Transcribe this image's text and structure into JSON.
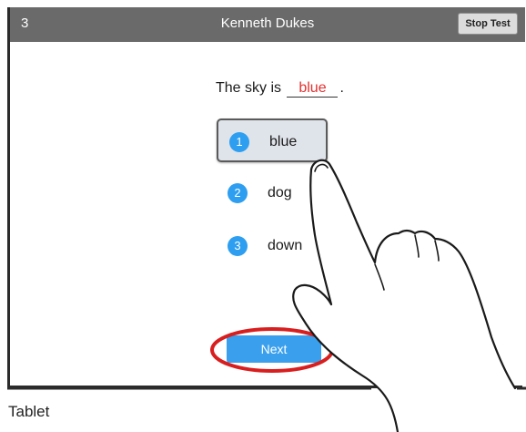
{
  "header": {
    "question_number": "3",
    "student_name": "Kenneth Dukes",
    "stop_test_label": "Stop Test"
  },
  "question": {
    "prefix": "The sky is",
    "answer": "blue",
    "suffix": "."
  },
  "options": [
    {
      "number": "1",
      "label": "blue",
      "selected": true
    },
    {
      "number": "2",
      "label": "dog",
      "selected": false
    },
    {
      "number": "3",
      "label": "down",
      "selected": false
    }
  ],
  "next_label": "Next",
  "device_label": "Tablet",
  "colors": {
    "header_bg": "#6a6a6a",
    "accent_blue": "#2e9ef0",
    "answer_red": "#e53030",
    "highlight_ring": "#d81e1e",
    "selected_bg": "#dfe3ea"
  }
}
